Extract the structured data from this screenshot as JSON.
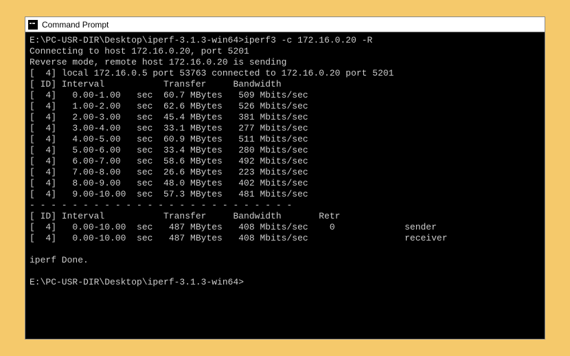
{
  "window": {
    "title": "Command Prompt"
  },
  "terminal": {
    "prompt_path": "E:\\PC-USR-DIR\\Desktop\\iperf-3.1.3-win64>",
    "command": "iperf3 -c 172.16.0.20 -R",
    "line_connecting": "Connecting to host 172.16.0.20, port 5201",
    "line_reverse": "Reverse mode, remote host 172.16.0.20 is sending",
    "line_local": "[  4] local 172.16.0.5 port 53763 connected to 172.16.0.20 port 5201",
    "header1": "[ ID] Interval           Transfer     Bandwidth",
    "rows": [
      "[  4]   0.00-1.00   sec  60.7 MBytes   509 Mbits/sec",
      "[  4]   1.00-2.00   sec  62.6 MBytes   526 Mbits/sec",
      "[  4]   2.00-3.00   sec  45.4 MBytes   381 Mbits/sec",
      "[  4]   3.00-4.00   sec  33.1 MBytes   277 Mbits/sec",
      "[  4]   4.00-5.00   sec  60.9 MBytes   511 Mbits/sec",
      "[  4]   5.00-6.00   sec  33.4 MBytes   280 Mbits/sec",
      "[  4]   6.00-7.00   sec  58.6 MBytes   492 Mbits/sec",
      "[  4]   7.00-8.00   sec  26.6 MBytes   223 Mbits/sec",
      "[  4]   8.00-9.00   sec  48.0 MBytes   402 Mbits/sec",
      "[  4]   9.00-10.00  sec  57.3 MBytes   481 Mbits/sec"
    ],
    "separator": "- - - - - - - - - - - - - - - - - - - - - - - - -",
    "header2": "[ ID] Interval           Transfer     Bandwidth       Retr",
    "summary": [
      "[  4]   0.00-10.00  sec   487 MBytes   408 Mbits/sec    0             sender",
      "[  4]   0.00-10.00  sec   487 MBytes   408 Mbits/sec                  receiver"
    ],
    "done": "iperf Done.",
    "prompt2": "E:\\PC-USR-DIR\\Desktop\\iperf-3.1.3-win64>"
  }
}
